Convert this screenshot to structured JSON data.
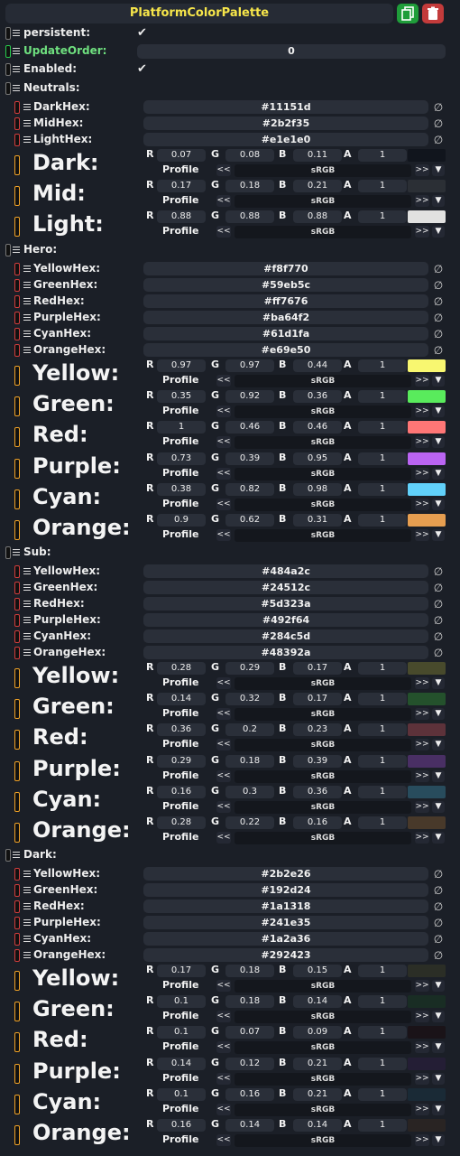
{
  "title": "PlatformColorPalette",
  "persistent_label": "persistent:",
  "update_order_label": "UpdateOrder:",
  "update_order_value": "0",
  "enabled_label": "Enabled:",
  "check_glyph": "✔",
  "clear_glyph": "∅",
  "profile_label": "Profile",
  "profile_value": "sRGB",
  "prev_label": "<<",
  "next_label": ">>",
  "dropdown_glyph": "▼",
  "ch_labels": [
    "R",
    "G",
    "B",
    "A"
  ],
  "sections": [
    {
      "label": "Neutrals:",
      "hex": [
        {
          "label": "DarkHex:",
          "value": "#11151d"
        },
        {
          "label": "MidHex:",
          "value": "#2b2f35"
        },
        {
          "label": "LightHex:",
          "value": "#e1e1e0"
        }
      ],
      "colors": [
        {
          "label": "Dark:",
          "r": "0.07",
          "g": "0.08",
          "b": "0.11",
          "a": "1",
          "swatch": "#11151d"
        },
        {
          "label": "Mid:",
          "r": "0.17",
          "g": "0.18",
          "b": "0.21",
          "a": "1",
          "swatch": "#2b2f35"
        },
        {
          "label": "Light:",
          "r": "0.88",
          "g": "0.88",
          "b": "0.88",
          "a": "1",
          "swatch": "#e1e1e0"
        }
      ]
    },
    {
      "label": "Hero:",
      "hex": [
        {
          "label": "YellowHex:",
          "value": "#f8f770"
        },
        {
          "label": "GreenHex:",
          "value": "#59eb5c"
        },
        {
          "label": "RedHex:",
          "value": "#ff7676"
        },
        {
          "label": "PurpleHex:",
          "value": "#ba64f2"
        },
        {
          "label": "CyanHex:",
          "value": "#61d1fa"
        },
        {
          "label": "OrangeHex:",
          "value": "#e69e50"
        }
      ],
      "colors": [
        {
          "label": "Yellow:",
          "r": "0.97",
          "g": "0.97",
          "b": "0.44",
          "a": "1",
          "swatch": "#f8f770"
        },
        {
          "label": "Green:",
          "r": "0.35",
          "g": "0.92",
          "b": "0.36",
          "a": "1",
          "swatch": "#59eb5c"
        },
        {
          "label": "Red:",
          "r": "1",
          "g": "0.46",
          "b": "0.46",
          "a": "1",
          "swatch": "#ff7676"
        },
        {
          "label": "Purple:",
          "r": "0.73",
          "g": "0.39",
          "b": "0.95",
          "a": "1",
          "swatch": "#ba64f2"
        },
        {
          "label": "Cyan:",
          "r": "0.38",
          "g": "0.82",
          "b": "0.98",
          "a": "1",
          "swatch": "#61d1fa"
        },
        {
          "label": "Orange:",
          "r": "0.9",
          "g": "0.62",
          "b": "0.31",
          "a": "1",
          "swatch": "#e69e50"
        }
      ]
    },
    {
      "label": "Sub:",
      "hex": [
        {
          "label": "YellowHex:",
          "value": "#484a2c"
        },
        {
          "label": "GreenHex:",
          "value": "#24512c"
        },
        {
          "label": "RedHex:",
          "value": "#5d323a"
        },
        {
          "label": "PurpleHex:",
          "value": "#492f64"
        },
        {
          "label": "CyanHex:",
          "value": "#284c5d"
        },
        {
          "label": "OrangeHex:",
          "value": "#48392a"
        }
      ],
      "colors": [
        {
          "label": "Yellow:",
          "r": "0.28",
          "g": "0.29",
          "b": "0.17",
          "a": "1",
          "swatch": "#484a2c"
        },
        {
          "label": "Green:",
          "r": "0.14",
          "g": "0.32",
          "b": "0.17",
          "a": "1",
          "swatch": "#24512c"
        },
        {
          "label": "Red:",
          "r": "0.36",
          "g": "0.2",
          "b": "0.23",
          "a": "1",
          "swatch": "#5d323a"
        },
        {
          "label": "Purple:",
          "r": "0.29",
          "g": "0.18",
          "b": "0.39",
          "a": "1",
          "swatch": "#492f64"
        },
        {
          "label": "Cyan:",
          "r": "0.16",
          "g": "0.3",
          "b": "0.36",
          "a": "1",
          "swatch": "#284c5d"
        },
        {
          "label": "Orange:",
          "r": "0.28",
          "g": "0.22",
          "b": "0.16",
          "a": "1",
          "swatch": "#48392a"
        }
      ]
    },
    {
      "label": "Dark:",
      "hex": [
        {
          "label": "YellowHex:",
          "value": "#2b2e26"
        },
        {
          "label": "GreenHex:",
          "value": "#192d24"
        },
        {
          "label": "RedHex:",
          "value": "#1a1318"
        },
        {
          "label": "PurpleHex:",
          "value": "#241e35"
        },
        {
          "label": "CyanHex:",
          "value": "#1a2a36"
        },
        {
          "label": "OrangeHex:",
          "value": "#292423"
        }
      ],
      "colors": [
        {
          "label": "Yellow:",
          "r": "0.17",
          "g": "0.18",
          "b": "0.15",
          "a": "1",
          "swatch": "#2b2e26"
        },
        {
          "label": "Green:",
          "r": "0.1",
          "g": "0.18",
          "b": "0.14",
          "a": "1",
          "swatch": "#192d24"
        },
        {
          "label": "Red:",
          "r": "0.1",
          "g": "0.07",
          "b": "0.09",
          "a": "1",
          "swatch": "#1a1318"
        },
        {
          "label": "Purple:",
          "r": "0.14",
          "g": "0.12",
          "b": "0.21",
          "a": "1",
          "swatch": "#241e35"
        },
        {
          "label": "Cyan:",
          "r": "0.1",
          "g": "0.16",
          "b": "0.21",
          "a": "1",
          "swatch": "#1a2a36"
        },
        {
          "label": "Orange:",
          "r": "0.16",
          "g": "0.14",
          "b": "0.14",
          "a": "1",
          "swatch": "#292423"
        }
      ]
    }
  ]
}
